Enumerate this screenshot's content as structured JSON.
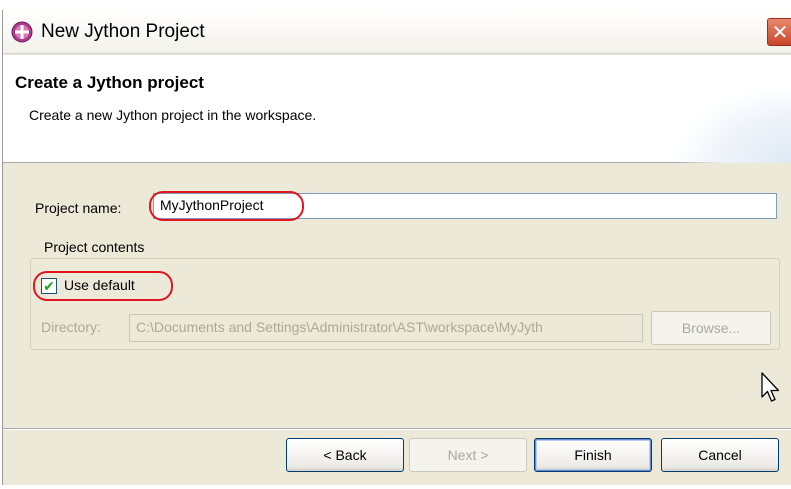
{
  "window": {
    "title": "New Jython Project",
    "close_glyph": "✕",
    "icon": "jython-project-icon"
  },
  "header": {
    "title": "Create a Jython project",
    "description": "Create a new Jython project in the workspace."
  },
  "form": {
    "project_name_label": "Project name:",
    "project_name_value": "MyJythonProject",
    "group_label": "Project contents",
    "use_default_label": "Use default",
    "use_default_checked": true,
    "directory_label": "Directory:",
    "directory_value": "C:\\Documents and Settings\\Administrator\\AST\\workspace\\MyJyth",
    "browse_label": "Browse..."
  },
  "buttons": {
    "back": "< Back",
    "next": "Next >",
    "finish": "Finish",
    "cancel": "Cancel"
  },
  "colors": {
    "dialog_bg": "#ece9d8",
    "annotation_red": "#e0161e",
    "close_button": "#c7472b"
  }
}
